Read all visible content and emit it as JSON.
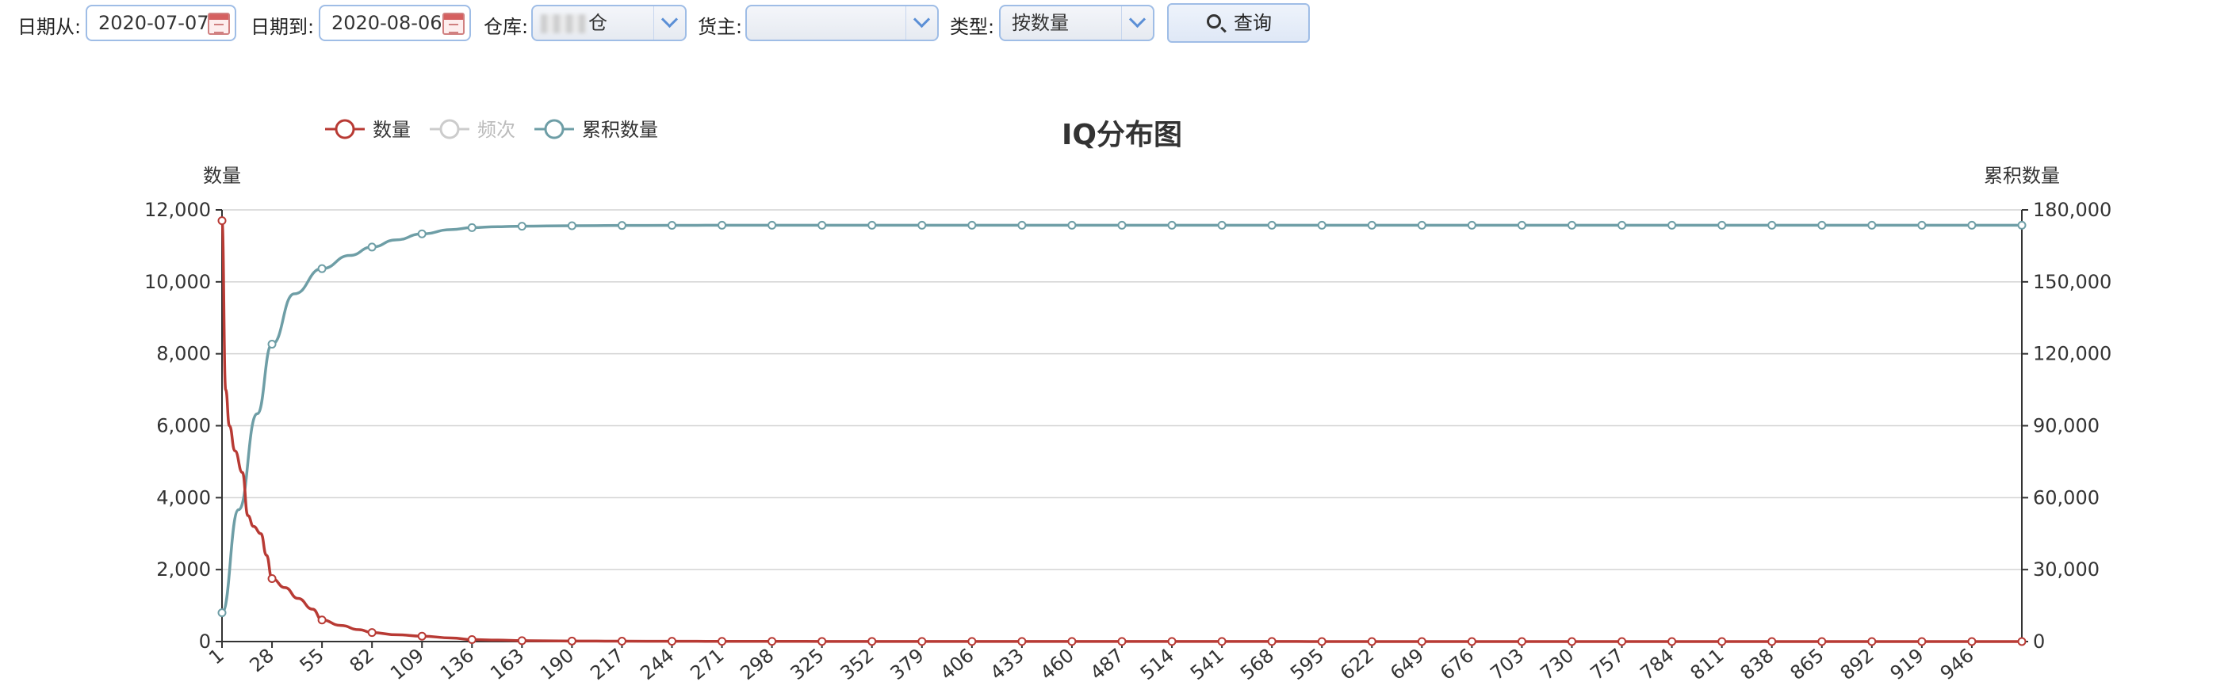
{
  "toolbar": {
    "date_from_label": "日期从:",
    "date_from_value": "2020-07-07",
    "date_to_label": "日期到:",
    "date_to_value": "2020-08-06",
    "warehouse_label": "仓库:",
    "warehouse_value": "仓",
    "owner_label": "货主:",
    "owner_value": "",
    "type_label": "类型:",
    "type_value": "按数量",
    "query_label": "查询"
  },
  "chart_data": {
    "type": "line",
    "title": "IQ分布图",
    "legend_position": "top-left",
    "grid": true,
    "left_axis": {
      "label": "数量",
      "min": 0,
      "max": 12000,
      "ticks": [
        "0",
        "2,000",
        "4,000",
        "6,000",
        "8,000",
        "10,000",
        "12,000"
      ]
    },
    "right_axis": {
      "label": "累积数量",
      "min": 0,
      "max": 180000,
      "ticks": [
        "0",
        "30,000",
        "60,000",
        "90,000",
        "120,000",
        "150,000",
        "180,000"
      ]
    },
    "x_axis": {
      "min": 1,
      "max": 973,
      "ticks": [
        1,
        28,
        55,
        82,
        109,
        136,
        163,
        190,
        217,
        244,
        271,
        298,
        325,
        352,
        379,
        406,
        433,
        460,
        487,
        514,
        541,
        568,
        595,
        622,
        649,
        676,
        703,
        730,
        757,
        784,
        811,
        838,
        865,
        892,
        919,
        946
      ]
    },
    "series": [
      {
        "name": "数量",
        "axis": "left",
        "color": "#b83a34",
        "visible": true,
        "x": [
          1,
          3,
          5,
          8,
          12,
          15,
          18,
          22,
          25,
          28,
          35,
          42,
          50,
          55,
          65,
          75,
          82,
          95,
          109,
          125,
          136,
          150,
          163,
          190,
          217,
          244,
          271,
          298,
          325,
          352,
          379,
          406,
          433,
          460,
          487,
          514,
          541,
          568,
          595,
          622,
          649,
          676,
          703,
          730,
          757,
          784,
          811,
          838,
          865,
          892,
          919,
          946,
          973
        ],
        "values": [
          11700,
          7000,
          6000,
          5300,
          4700,
          3500,
          3200,
          3000,
          2400,
          1750,
          1500,
          1200,
          900,
          600,
          450,
          330,
          250,
          190,
          150,
          100,
          55,
          40,
          25,
          15,
          10,
          8,
          6,
          5,
          4,
          4,
          3,
          3,
          3,
          2,
          2,
          2,
          2,
          2,
          1,
          1,
          1,
          1,
          1,
          1,
          1,
          1,
          1,
          1,
          1,
          1,
          1,
          1,
          1
        ]
      },
      {
        "name": "频次",
        "axis": "left",
        "color": "#cfcfcf",
        "visible": false,
        "values": []
      },
      {
        "name": "累积数量",
        "axis": "right",
        "color": "#6e9ea6",
        "visible": true,
        "x": [
          1,
          10,
          20,
          28,
          40,
          55,
          70,
          82,
          95,
          109,
          125,
          136,
          150,
          163,
          190,
          217,
          244,
          271,
          298,
          325,
          352,
          379,
          406,
          433,
          460,
          487,
          514,
          541,
          568,
          595,
          622,
          649,
          676,
          703,
          730,
          757,
          784,
          811,
          838,
          865,
          892,
          919,
          946,
          973
        ],
        "values": [
          12000,
          55000,
          95000,
          124000,
          145000,
          155500,
          161000,
          164500,
          167500,
          170000,
          171800,
          172600,
          173000,
          173200,
          173400,
          173500,
          173550,
          173600,
          173600,
          173600,
          173600,
          173600,
          173600,
          173600,
          173600,
          173600,
          173600,
          173600,
          173600,
          173600,
          173600,
          173600,
          173600,
          173600,
          173600,
          173600,
          173600,
          173600,
          173600,
          173600,
          173600,
          173600,
          173600,
          173600
        ]
      }
    ]
  }
}
